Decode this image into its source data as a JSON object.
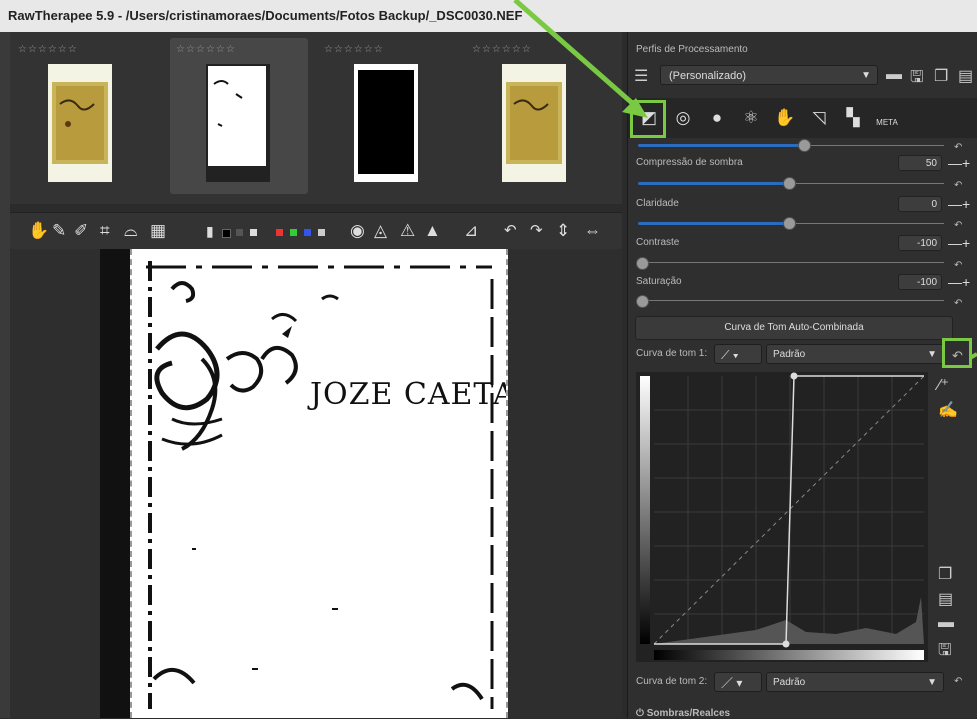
{
  "window": {
    "title": "RawTherapee 5.9 - /Users/cristinamoraes/Documents/Fotos Backup/_DSC0030.NEF"
  },
  "filmstrip": {
    "thumbnails": [
      {
        "rating": "☆☆☆☆☆☆",
        "selected": false
      },
      {
        "rating": "☆☆☆☆☆☆",
        "selected": true
      },
      {
        "rating": "☆☆☆☆☆☆",
        "selected": false
      },
      {
        "rating": "☆☆☆☆☆☆",
        "selected": false
      }
    ]
  },
  "document": {
    "visible_text": "JOZE CAETANO"
  },
  "sidebar": {
    "profiles_label": "Perfis de Processamento",
    "profile_value": "(Personalizado)",
    "meta_tab": "META",
    "sliders": [
      {
        "label": "Compressão de sombra",
        "value": "50",
        "level": 0.5
      },
      {
        "label": "Claridade",
        "value": "0",
        "level": 0.5
      },
      {
        "label": "Contraste",
        "value": "-100",
        "level": 0.0
      },
      {
        "label": "Saturação",
        "value": "-100",
        "level": 0.0
      }
    ],
    "auto_curve_button": "Curva de Tom Auto-Combinada",
    "curve1_label": "Curva de tom 1:",
    "curve1_type": "Padrão",
    "curve2_label": "Curva de tom 2:",
    "curve2_type": "Padrão",
    "shadows_section": "Sombras/Realces"
  },
  "colors": {
    "highlight": "#7ac943",
    "slider": "#2a6cc0"
  }
}
